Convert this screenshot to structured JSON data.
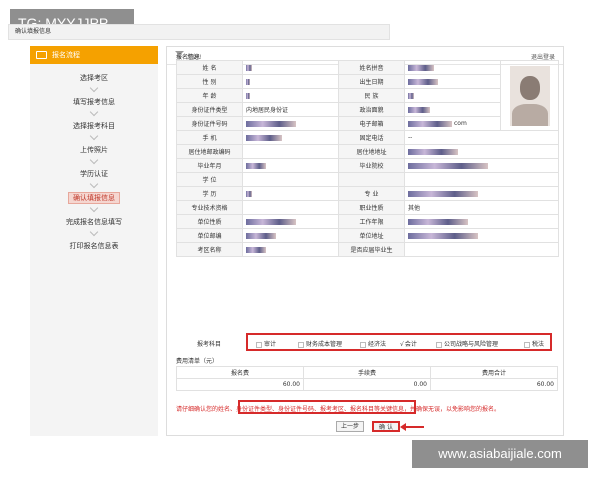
{
  "watermark_top": "TG: MYYJJPP",
  "watermark_bottom": "www.asiabaijiale.com",
  "sidebar": {
    "title": "报名流程",
    "steps": [
      {
        "label": "选择考区"
      },
      {
        "label": "填写报考信息"
      },
      {
        "label": "选择报考科目"
      },
      {
        "label": "上传照片"
      },
      {
        "label": "学历认证"
      },
      {
        "label": "确认填报信息",
        "active": true
      },
      {
        "label": "完成报名信息填写"
      },
      {
        "label": "打印报名信息表"
      }
    ]
  },
  "topbar": {
    "greeting": "您好!",
    "logout": "退出登录"
  },
  "confirm_title": "确认填报信息",
  "info_section": "报名信息",
  "info": {
    "name": "姓 名",
    "name_pinyin": "姓名拼音",
    "gender": "性 别",
    "birthdate": "出生日期",
    "age": "年 龄",
    "ethnicity": "民 族",
    "id_type": "身份证件类型",
    "id_type_value": "内地居民身份证",
    "political": "政治面貌",
    "id_number": "身份证件号码",
    "email": "电子邮箱",
    "email_suffix": "com",
    "mobile": "手 机",
    "phone": "固定电话",
    "phone_value": "--",
    "postcode": "居住地邮政编码",
    "address": "居住地地址",
    "grad_year": "毕业年月",
    "school": "毕业院校",
    "degree": "学 位",
    "education": "学 历",
    "major": "专 业",
    "title_qual": "专业技术资格",
    "job": "职业性质",
    "job_value": "其他",
    "employer": "单位性质",
    "work_years": "工作年限",
    "work_post": "单位邮编",
    "work_address": "单位地址",
    "area": "考区名称",
    "is_graduate": "是否应届毕业生"
  },
  "subjects": {
    "label": "报考科目",
    "items": [
      {
        "label": "审计",
        "checked": false
      },
      {
        "label": "财务成本管理",
        "checked": false
      },
      {
        "label": "经济法",
        "checked": false
      },
      {
        "label": "会计",
        "checked": true
      },
      {
        "label": "公司战略与风险管理",
        "checked": false
      },
      {
        "label": "税法",
        "checked": false
      }
    ]
  },
  "fee_section": "费用清单（元）",
  "fees": {
    "headers": [
      "报名费",
      "手续费",
      "费用合计"
    ],
    "values": [
      "60.00",
      "0.00",
      "60.00"
    ]
  },
  "notice": "请仔细确认您的姓名、身份证件类型、身份证件号码、报考考区、报名科目等关键信息，并确保无误，以免影响您的报名。",
  "buttons": {
    "prev": "上一步",
    "confirm": "确 认"
  }
}
